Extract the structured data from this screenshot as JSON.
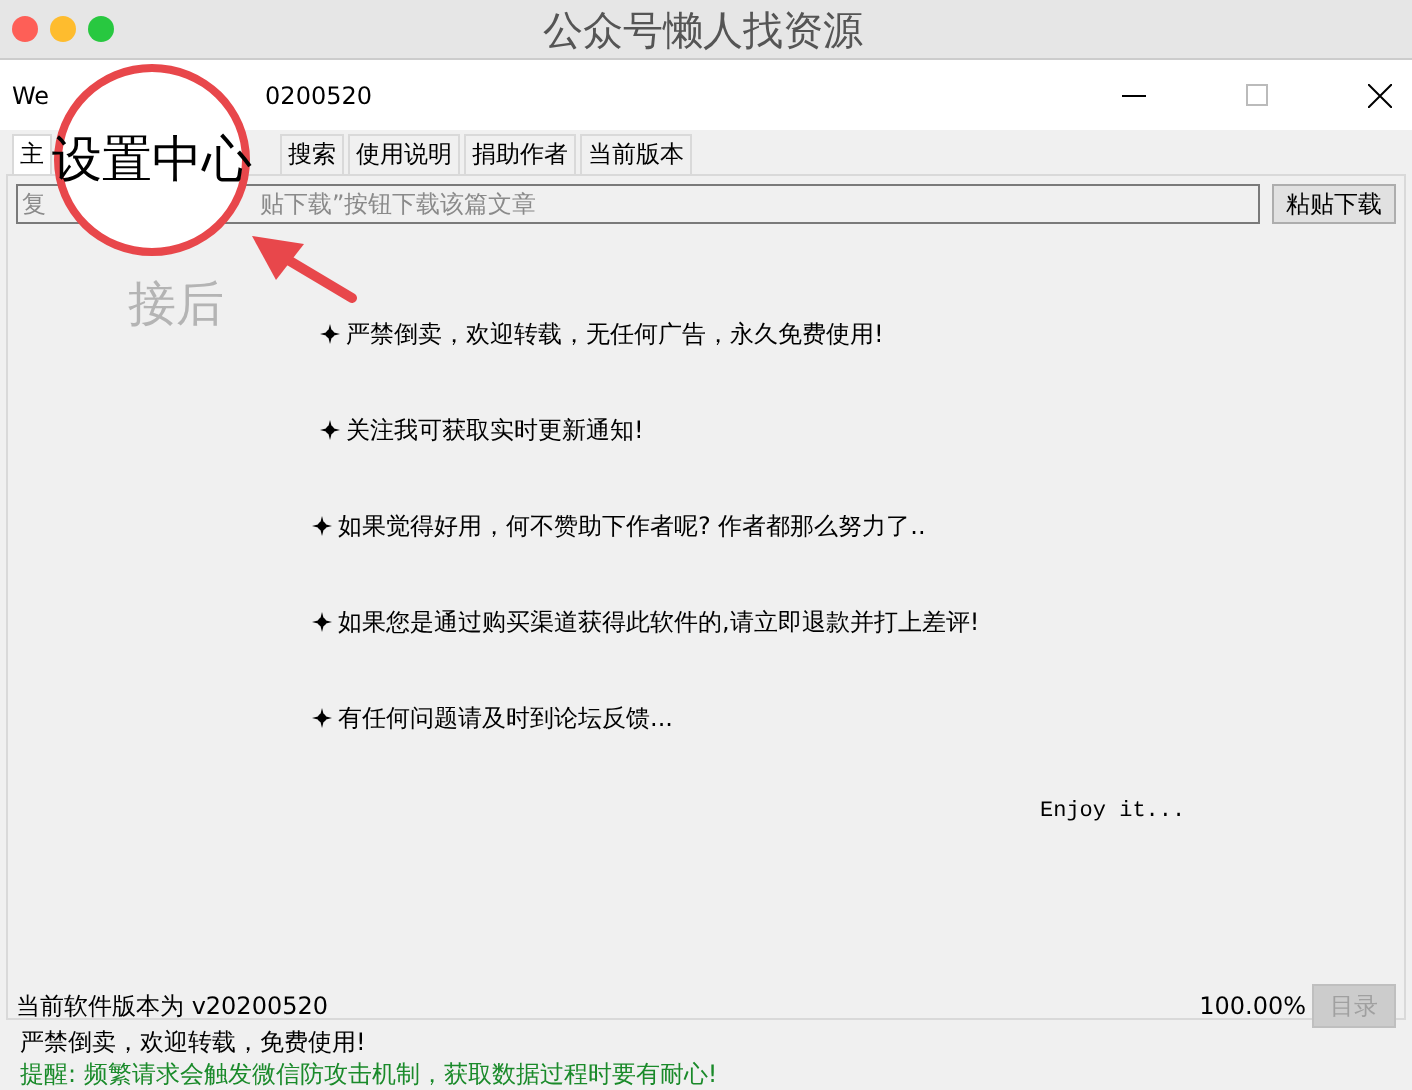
{
  "mac_window": {
    "title": "公众号懒人找资源"
  },
  "window": {
    "title_parts": [
      "We",
      "0200520"
    ]
  },
  "tabs": [
    {
      "label": "主",
      "selected": true
    },
    {
      "label": "搜索",
      "selected": false
    },
    {
      "label": "使用说明",
      "selected": false
    },
    {
      "label": "捐助作者",
      "selected": false
    },
    {
      "label": "当前版本",
      "selected": false
    }
  ],
  "url_field": {
    "placeholder_parts": [
      "复",
      "贴下载”按钮下载该篇文章"
    ]
  },
  "paste_button": "粘贴下载",
  "hint_fragment": "接后",
  "notices": [
    "严禁倒卖，欢迎转载，无任何广告，永久免费使用!",
    "关注我可获取实时更新通知!",
    "如果觉得好用，何不赞助下作者呢? 作者都那么努力了..",
    "如果您是通过购买渠道获得此软件的,请立即退款并打上差评!",
    "有任何问题请及时到论坛反馈..."
  ],
  "closing": "Enjoy it...",
  "version_text": "当前软件版本为 v20200520",
  "progress_text": "100.00%",
  "catalog_button": {
    "label": "目录",
    "disabled": true
  },
  "status": [
    {
      "text": "严禁倒卖，欢迎转载，免费使用!",
      "kind": "plain"
    },
    {
      "text": "提醒: 频繁请求会触发微信防攻击机制，获取数据过程时要有耐心!",
      "kind": "warning"
    }
  ],
  "callout": {
    "text": "设置中心"
  }
}
